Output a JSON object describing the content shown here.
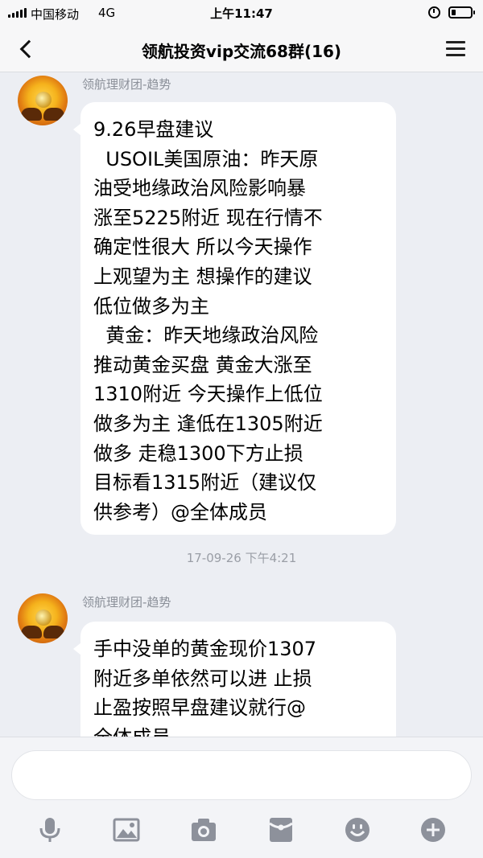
{
  "status_bar": {
    "carrier": "中国移动",
    "network": "4G",
    "time": "上午11:47"
  },
  "nav": {
    "title": "领航投资vip交流68群(16)"
  },
  "messages": [
    {
      "sender": "领航理财团-趋势",
      "lines": [
        "9.26早盘建议",
        "  USOIL美国原油：昨天原",
        "油受地缘政治风险影响暴",
        "涨至5225附近 现在行情不",
        "确定性很大 所以今天操作",
        "上观望为主 想操作的建议",
        "低位做多为主",
        "  黄金：昨天地缘政治风险",
        "推动黄金买盘 黄金大涨至",
        "1310附近 今天操作上低位",
        "做多为主 逢低在1305附近",
        "做多 走稳1300下方止损",
        "目标看1315附近（建议仅",
        "供参考）@全体成员"
      ]
    },
    {
      "sender": "领航理财团-趋势",
      "lines": [
        "手中没单的黄金现价1307",
        "附近多单依然可以进 止损",
        "止盈按照早盘建议就行@",
        "全体成员"
      ]
    }
  ],
  "timestamp": "17-09-26 下午4:21",
  "input": {
    "placeholder": ""
  },
  "toolbar_icons": [
    "microphone-icon",
    "image-icon",
    "camera-icon",
    "red-packet-icon",
    "emoji-icon",
    "plus-icon"
  ],
  "colors": {
    "chat_background": "#eceef3",
    "bubble": "#ffffff",
    "secondary_text": "#8a8f98",
    "icon_gray": "#8d919b"
  }
}
